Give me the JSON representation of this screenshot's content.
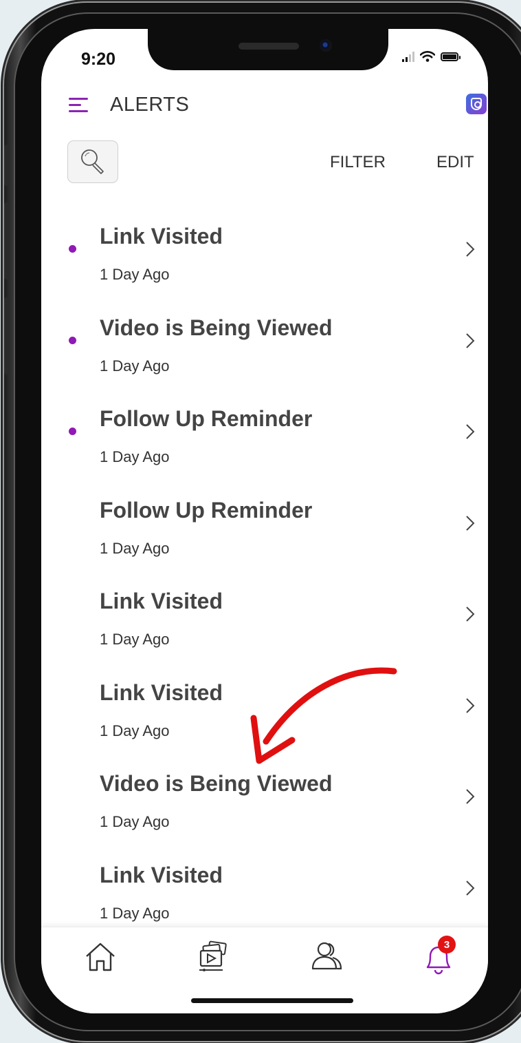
{
  "status_bar": {
    "time": "9:20"
  },
  "header": {
    "title": "ALERTS"
  },
  "toolbar": {
    "filter_label": "FILTER",
    "edit_label": "EDIT"
  },
  "alerts": [
    {
      "title": "Link Visited",
      "time": "1 Day Ago",
      "unread": true
    },
    {
      "title": "Video is Being Viewed",
      "time": "1 Day Ago",
      "unread": true
    },
    {
      "title": "Follow Up Reminder",
      "time": "1 Day Ago",
      "unread": true
    },
    {
      "title": "Follow Up Reminder",
      "time": "1 Day Ago",
      "unread": false
    },
    {
      "title": "Link Visited",
      "time": "1 Day Ago",
      "unread": false
    },
    {
      "title": "Link Visited",
      "time": "1 Day Ago",
      "unread": false
    },
    {
      "title": "Video is Being Viewed",
      "time": "1 Day Ago",
      "unread": false
    },
    {
      "title": "Link Visited",
      "time": "1 Day Ago",
      "unread": false
    }
  ],
  "tabbar": {
    "items": [
      {
        "icon": "home-icon"
      },
      {
        "icon": "media-icon"
      },
      {
        "icon": "contacts-icon"
      },
      {
        "icon": "bell-icon",
        "badge": "3"
      }
    ]
  },
  "colors": {
    "accent": "#9119b5",
    "badge": "#e31313",
    "annotation_arrow": "#e01010"
  }
}
